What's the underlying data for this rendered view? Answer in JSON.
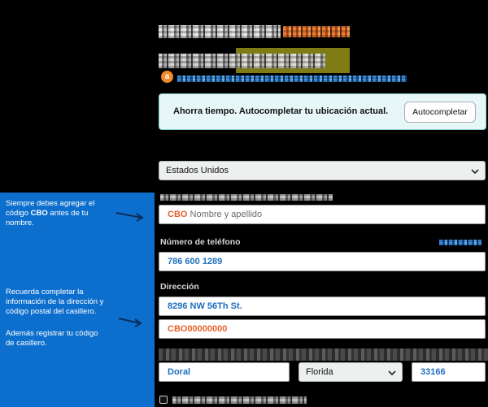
{
  "colors": {
    "background": "#000000",
    "panel_blue": "#0d6fcd",
    "accent_orange": "#e8622a",
    "value_blue": "#1f6fbf",
    "autofill_bg": "#e7f7f7"
  },
  "header": {
    "badge_letter": "a"
  },
  "autofill": {
    "message": "Ahorra tiempo. Autocompletar tu ubicación actual.",
    "button_label": "Autocompletar"
  },
  "country_select": {
    "value": "Estados Unidos",
    "icon": "chevron-down-icon"
  },
  "name_field": {
    "code": "CBO",
    "placeholder": "Nombre y apellido"
  },
  "phone_field": {
    "label": "Número de teléfono",
    "value": "786 600 1289"
  },
  "address_field": {
    "label": "Dirección",
    "line1": "8296 NW 56Th St.",
    "line2": "CBO00000000"
  },
  "city_field": {
    "value": "Doral"
  },
  "state_select": {
    "value": "Florida",
    "icon": "chevron-down-icon"
  },
  "zip_field": {
    "value": "33166"
  },
  "notes": {
    "name": {
      "line1": "Siempre debes agregar el",
      "line2_pre": "código ",
      "line2_bold": "CBO",
      "line2_post": " antes de tu",
      "line3": "nombre."
    },
    "address": {
      "lines": [
        "Recuerda completar la",
        "información de la dirección y",
        "código postal del casillero."
      ]
    },
    "code": {
      "lines": [
        "Además registrar tu código",
        "de casillero."
      ]
    }
  }
}
